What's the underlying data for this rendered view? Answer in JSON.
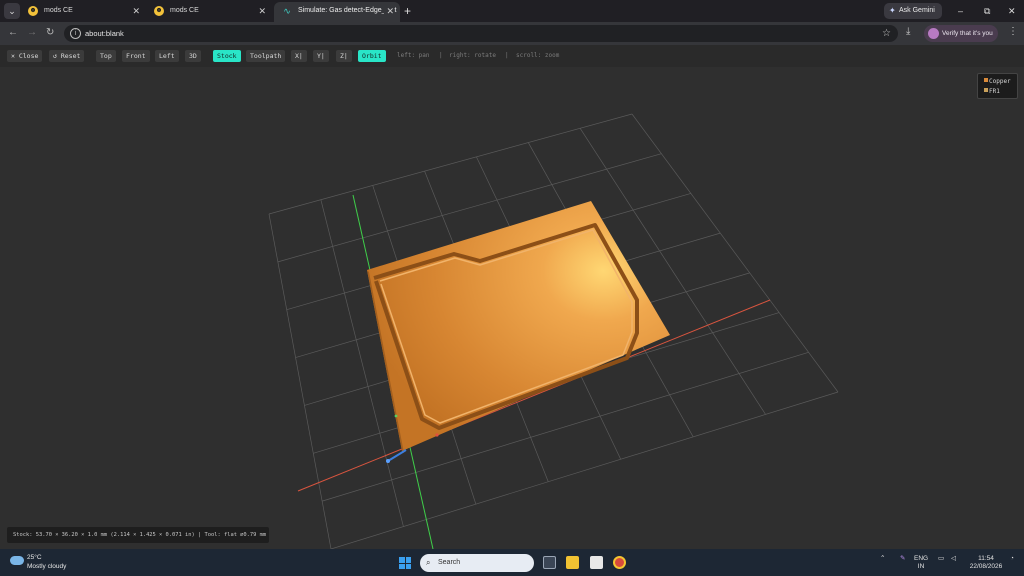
{
  "browser": {
    "tabs": [
      {
        "title": "mods CE",
        "active": false
      },
      {
        "title": "mods CE",
        "active": false
      },
      {
        "title": "Simulate: Gas detect-Edge_Cut",
        "active": true
      }
    ],
    "new_tab": "+",
    "ask_gemini": "Ask Gemini",
    "window_controls": {
      "minimize": "–",
      "restore": "⧉",
      "close": "✕"
    },
    "url": "about:blank",
    "verify": "Verify that it's you"
  },
  "toolbar": {
    "buttons": [
      "✕ Close",
      "↺ Reset",
      "Top",
      "Front",
      "Left",
      "3D",
      "Stock",
      "Toolpath",
      "X|",
      "Y|",
      "Z|",
      "Orbit"
    ],
    "active_buttons": [
      "Stock",
      "Orbit"
    ],
    "hints": [
      "left: pan",
      "|",
      "right: rotate",
      "|",
      "scroll: zoom"
    ]
  },
  "legend": {
    "items": [
      {
        "label": "Copper",
        "color": "#d98a3a"
      },
      {
        "label": "FR1",
        "color": "#c9a05a"
      }
    ]
  },
  "status": "Stock: 53.70 × 36.20 × 1.0 mm (2.114 × 1.425 × 0.071 in) | Tool: flat ⌀0.79 mm",
  "taskbar": {
    "temperature": "25°C",
    "weather": "Mostly cloudy",
    "search": "Search",
    "lang1": "ENG",
    "lang2": "IN",
    "time": "11:54",
    "date": "22/08/2026"
  },
  "colors": {
    "accent": "#29e5c7",
    "copper": "#d98a3a",
    "x_axis": "#d9553f",
    "y_axis": "#3fcf4a"
  }
}
